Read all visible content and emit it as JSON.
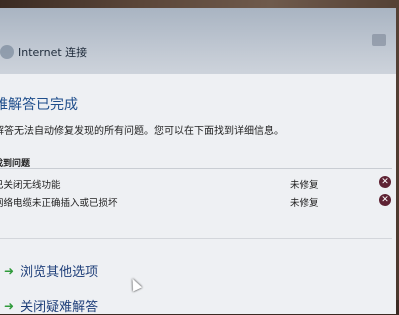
{
  "window": {
    "title": "Internet 连接"
  },
  "content": {
    "heading": "难解答已完成",
    "description": "解答无法自动修复发现的所有问题。您可以在下面找到详细信息。",
    "problems_label": "找到问题",
    "problems": [
      {
        "name": "已关闭无线功能",
        "status": "未修复"
      },
      {
        "name": "网络电缆未正确插入或已损坏",
        "status": "未修复"
      }
    ]
  },
  "options": {
    "explore": "浏览其他选项",
    "close": "关闭疑难解答"
  },
  "colors": {
    "heading": "#1f4e8c",
    "error_icon": "#5e2233",
    "option_arrow": "#2f9a3a"
  }
}
